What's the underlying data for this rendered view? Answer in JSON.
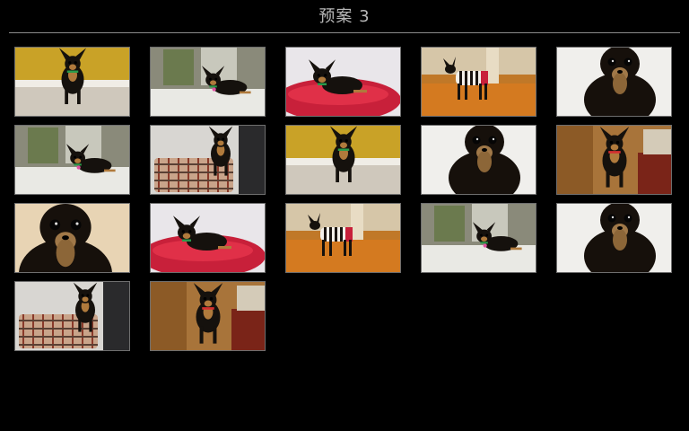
{
  "header": {
    "title": "预案 3"
  },
  "colors": {
    "background": "#000000",
    "title_text": "#b8b8b8",
    "divider": "#8a8a8a",
    "thumb_border": "#6e6e6e"
  },
  "thumbnails": [
    {
      "scene": "wall-yellow-standing",
      "bg": "#c9a227",
      "floor": "#cfc8bc"
    },
    {
      "scene": "window-lying-pink-tag",
      "bg": "#8a8a7a",
      "floor": "#e9e9e4"
    },
    {
      "scene": "red-cushion",
      "bg": "#e9e6ea",
      "floor": "#c8203a"
    },
    {
      "scene": "striped-sweater",
      "bg": "#c07828",
      "floor": "#d47a20"
    },
    {
      "scene": "closeup-white",
      "bg": "#f0efec",
      "floor": "#1a1410"
    },
    {
      "scene": "window-lying-pink-tag",
      "bg": "#8a8a7a",
      "floor": "#e9e9e4"
    },
    {
      "scene": "plaid-bag",
      "bg": "#d8d6d2",
      "floor": "#c9a48a"
    },
    {
      "scene": "wall-yellow-standing",
      "bg": "#c9a227",
      "floor": "#cfc8bc"
    },
    {
      "scene": "closeup-white",
      "bg": "#f0efec",
      "floor": "#1a1410"
    },
    {
      "scene": "chair-red-collar",
      "bg": "#a8743a",
      "floor": "#7a2418"
    },
    {
      "scene": "face-closeup",
      "bg": "#e8d4b4",
      "floor": "#1c140e"
    },
    {
      "scene": "red-cushion",
      "bg": "#e9e6ea",
      "floor": "#c8203a"
    },
    {
      "scene": "striped-sweater",
      "bg": "#c07828",
      "floor": "#d47a20"
    },
    {
      "scene": "window-lying-pink-tag",
      "bg": "#8a8a7a",
      "floor": "#e9e9e4"
    },
    {
      "scene": "closeup-white",
      "bg": "#f0efec",
      "floor": "#1a1410"
    },
    {
      "scene": "plaid-bag",
      "bg": "#d8d6d2",
      "floor": "#c9a48a"
    },
    {
      "scene": "chair-red-collar",
      "bg": "#a8743a",
      "floor": "#7a2418"
    }
  ]
}
